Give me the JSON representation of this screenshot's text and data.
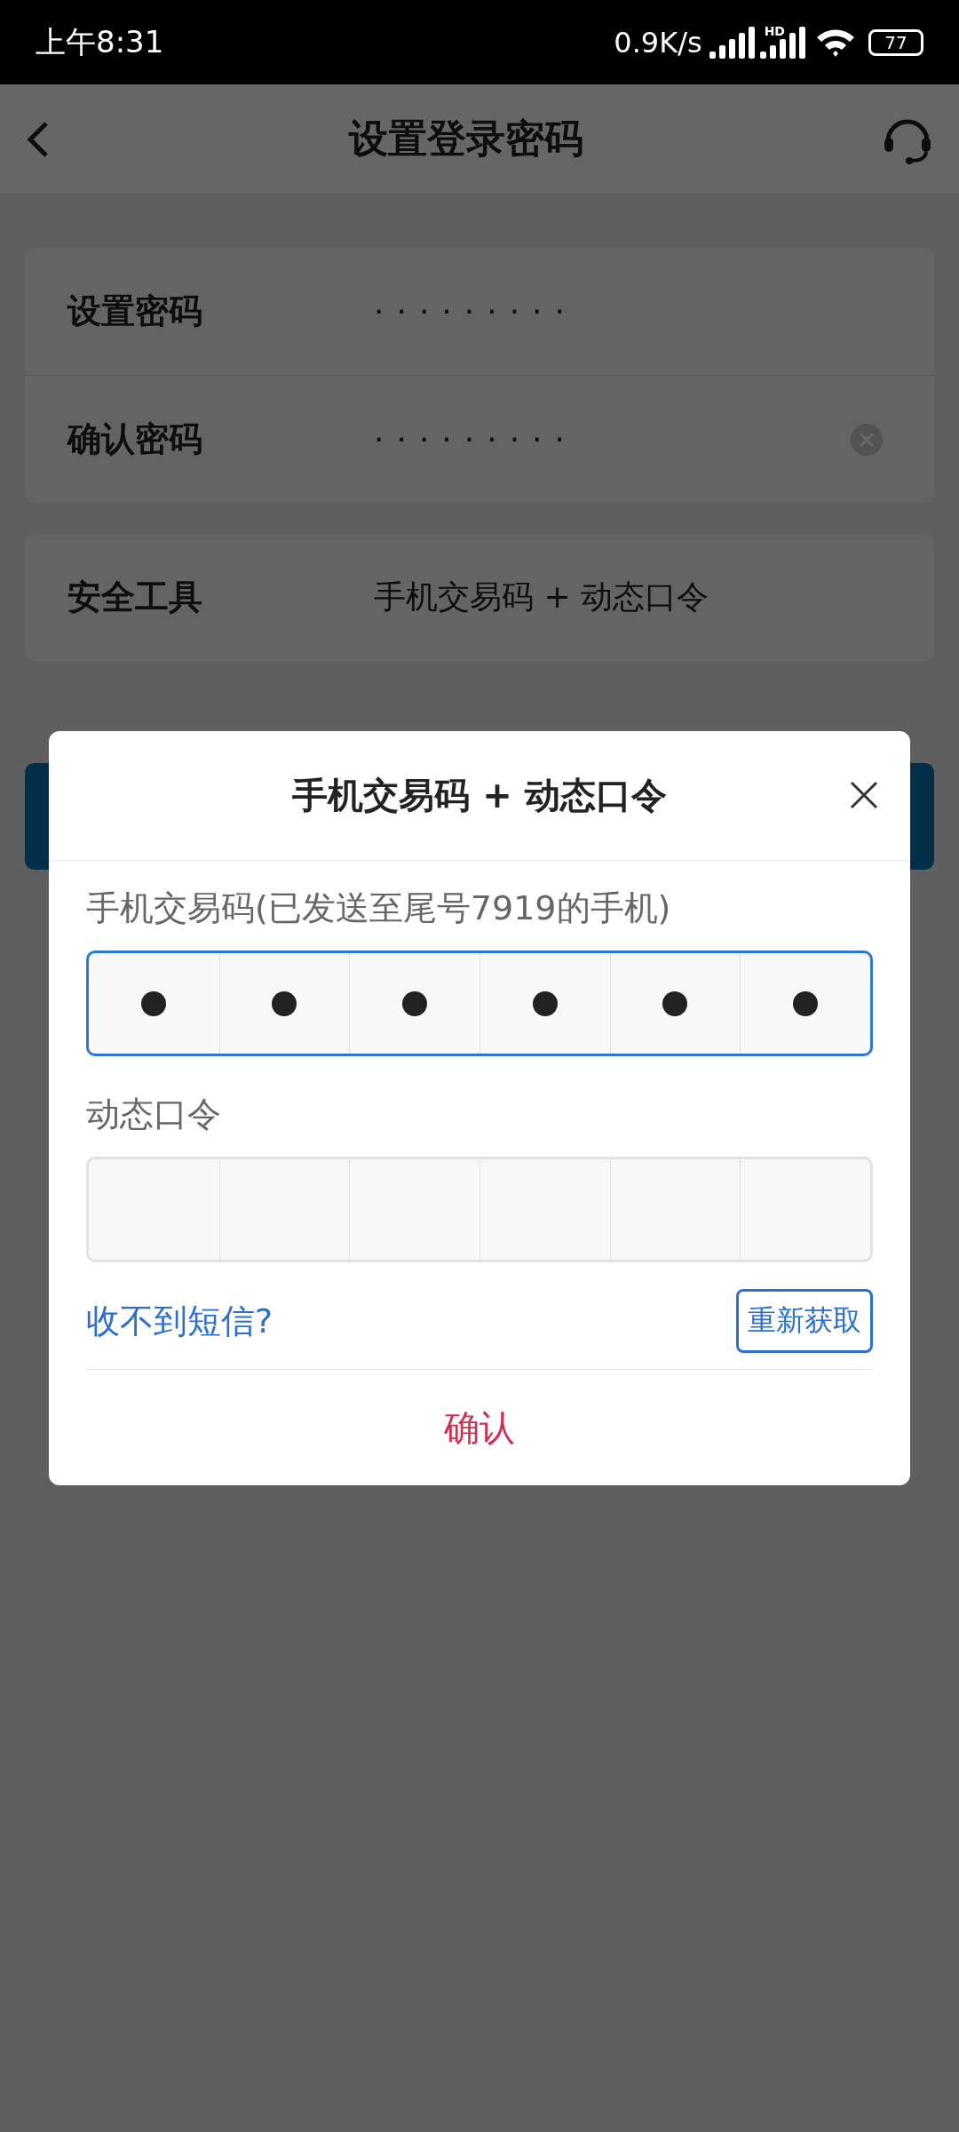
{
  "status_bar": {
    "time": "上午8:31",
    "speed": "0.9K/s",
    "network_badge": "HD",
    "battery": "77"
  },
  "header": {
    "title": "设置登录密码"
  },
  "password_rows": [
    {
      "label": "设置密码",
      "value": "·········",
      "clear_button": false
    },
    {
      "label": "确认密码",
      "value": "·········",
      "clear_button": true
    }
  ],
  "tool_row": {
    "label": "安全工具",
    "value": "手机交易码 + 动态口令"
  },
  "dialog": {
    "title": "手机交易码 + 动态口令",
    "fields": [
      {
        "label": "手机交易码(已发送至尾号7919的手机)",
        "focused": true,
        "cells": [
          {
            "filled": true
          },
          {
            "filled": true
          },
          {
            "filled": true
          },
          {
            "filled": true
          },
          {
            "filled": true
          },
          {
            "filled": true
          }
        ]
      },
      {
        "label": "动态口令",
        "focused": false,
        "cells": [
          {
            "filled": false
          },
          {
            "filled": false
          },
          {
            "filled": false
          },
          {
            "filled": false
          },
          {
            "filled": false
          },
          {
            "filled": false
          }
        ]
      }
    ],
    "help_link": "收不到短信?",
    "resend_button": "重新获取",
    "confirm_button": "确认"
  }
}
